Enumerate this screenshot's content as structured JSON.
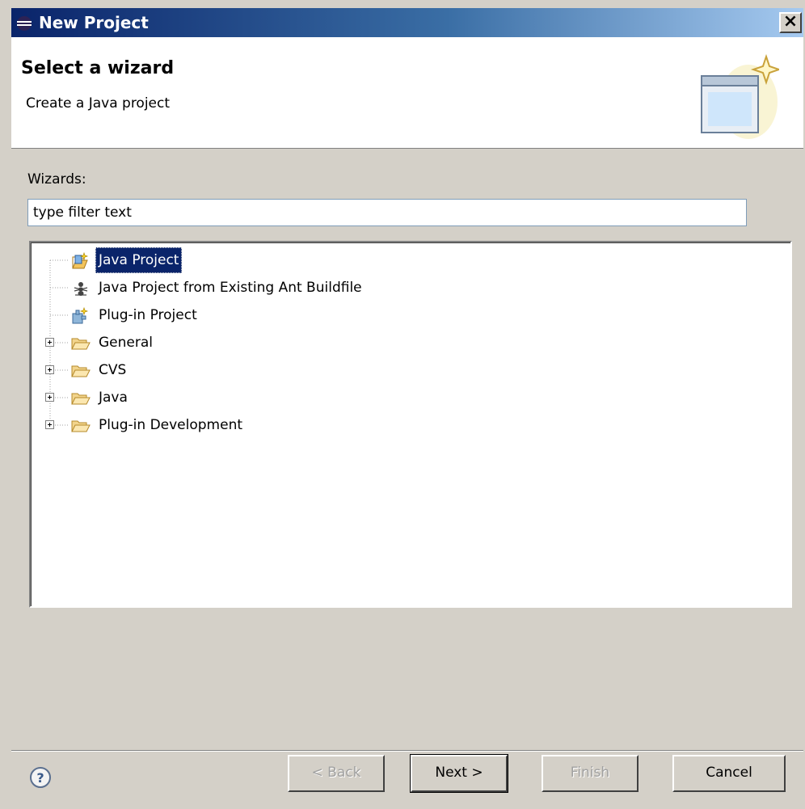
{
  "window": {
    "title": "New Project",
    "close_label": "×",
    "app_icon": "eclipse-icon"
  },
  "banner": {
    "heading": "Select a wizard",
    "description": "Create a Java project",
    "image_icon": "new-wizard-banner-icon"
  },
  "wizards_label": "Wizards:",
  "filter": {
    "value": "type filter text"
  },
  "tree": {
    "items": [
      {
        "label": "Java Project",
        "icon": "java-project-icon",
        "expandable": false,
        "selected": true
      },
      {
        "label": "Java Project from Existing Ant Buildfile",
        "icon": "ant-icon",
        "expandable": false,
        "selected": false
      },
      {
        "label": "Plug-in Project",
        "icon": "plugin-project-icon",
        "expandable": false,
        "selected": false
      },
      {
        "label": "General",
        "icon": "folder-icon",
        "expandable": true,
        "selected": false
      },
      {
        "label": "CVS",
        "icon": "folder-icon",
        "expandable": true,
        "selected": false
      },
      {
        "label": "Java",
        "icon": "folder-icon",
        "expandable": true,
        "selected": false
      },
      {
        "label": "Plug-in Development",
        "icon": "folder-icon",
        "expandable": true,
        "selected": false
      }
    ]
  },
  "buttons": {
    "back": "< Back",
    "next": "Next >",
    "finish": "Finish",
    "cancel": "Cancel",
    "help_icon": "help-icon"
  },
  "colors": {
    "title_bar_start": "#0a246a",
    "title_bar_end": "#a6caf0",
    "selection": "#0a246a",
    "dialog_background": "#d4d0c8"
  }
}
